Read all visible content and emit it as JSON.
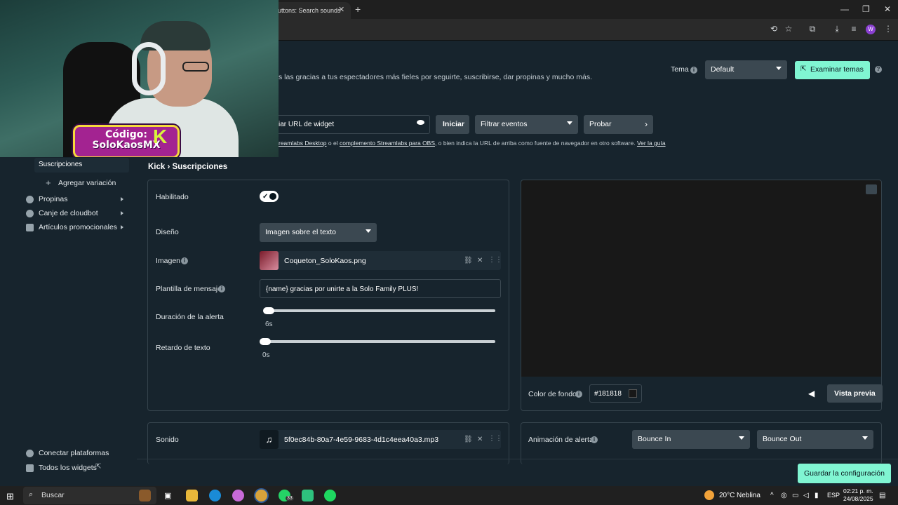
{
  "browser": {
    "tab_title": "uttons: Search sounds",
    "tab_close": "✕",
    "new_tab": "+",
    "min": "—",
    "max": "❐",
    "close": "✕",
    "profile_initial": "W"
  },
  "webcam": {
    "promo_line1": "Código:",
    "promo_line2": "SoloKaosMX",
    "logo_glyph": "K"
  },
  "header": {
    "lead_text": "s las gracias a tus espectadores más fieles por seguirte, suscribirse, dar propinas y mucho más.",
    "tema_label": "Tema",
    "tema_value": "Default",
    "examinar_label": "Examinar temas"
  },
  "widget_url": {
    "label": "iar URL de widget",
    "iniciar": "Iniciar",
    "filtrar": "Filtrar eventos",
    "probar": "Probar",
    "note_prefix": "",
    "note_link1": "reamlabs Desktop",
    "note_mid": " o el ",
    "note_link2": "complemento Streamlabs para OBS",
    "note_suffix": ", o bien indica la URL de arriba como fuente de navegador en otro software. ",
    "note_link3": "Ver la guía"
  },
  "sidebar": {
    "active_item": "Suscripciones",
    "add_variation": "Agregar variación",
    "items": [
      {
        "label": "Propinas",
        "icon": "tip-icon"
      },
      {
        "label": "Canje de cloudbot",
        "icon": "cloudbot-icon"
      },
      {
        "label": "Artículos promocionales",
        "icon": "shirt-icon"
      }
    ],
    "connect": "Conectar plataformas",
    "all_widgets": "Todos los widgets"
  },
  "breadcrumb": {
    "parent": "Kick",
    "sep": "›",
    "current": "Suscripciones"
  },
  "settings": {
    "enabled_label": "Habilitado",
    "enabled": true,
    "design_label": "Diseño",
    "design_value": "Imagen sobre el texto",
    "image_label": "Imagen",
    "image_file": "Coqueton_SoloKaos.png",
    "message_label": "Plantilla de mensaje",
    "message_value": "{name} gracias por unirte a la Solo Family PLUS!",
    "duration_label": "Duración de la alerta",
    "duration_value": "6s",
    "duration_fraction": 0.0,
    "delay_label": "Retardo de texto",
    "delay_value": "0s",
    "delay_fraction": 0.0,
    "sound_label": "Sonido",
    "sound_file": "5f0ec84b-80a7-4e59-9683-4d1c4eea40a3.mp3"
  },
  "preview": {
    "bg_label": "Color de fondo",
    "bg_value": "#181818",
    "vista_previa": "Vista previa",
    "anim_label": "Animación de alerta",
    "anim_in": "Bounce In",
    "anim_out": "Bounce Out"
  },
  "save_label": "Guardar la configuración",
  "taskbar": {
    "search": "Buscar",
    "whatsapp_badge": "33",
    "weather": "20°C",
    "weather_desc": "Neblina",
    "lang": "ESP",
    "time": "02:21 p. m.",
    "date": "24/08/2025"
  },
  "colors": {
    "accent": "#80f5d2",
    "background": "#17242d",
    "panel_border": "#35434c"
  }
}
